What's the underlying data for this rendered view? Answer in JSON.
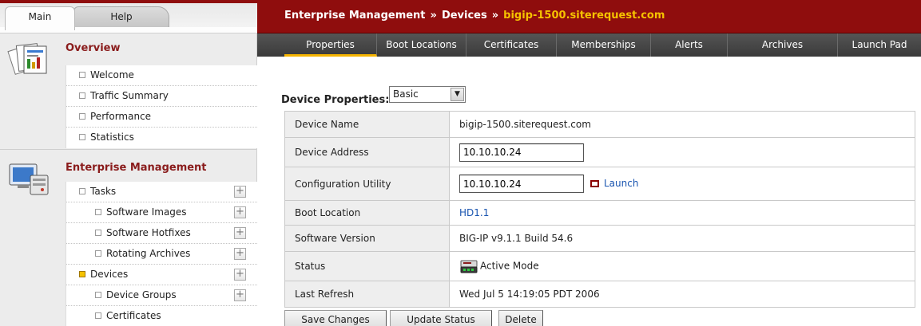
{
  "sidebar": {
    "tabs": {
      "main": "Main",
      "help": "Help"
    },
    "overview": {
      "title": "Overview",
      "items": [
        "Welcome",
        "Traffic Summary",
        "Performance",
        "Statistics"
      ]
    },
    "enterprise": {
      "title": "Enterprise Management",
      "items": {
        "tasks": "Tasks",
        "software_images": "Software Images",
        "software_hotfixes": "Software Hotfixes",
        "rotating_archives": "Rotating Archives",
        "devices": "Devices",
        "device_groups": "Device Groups",
        "certificates": "Certificates"
      }
    }
  },
  "breadcrumb": {
    "part1": "Enterprise Management",
    "part2": "Devices",
    "current": "bigip-1500.siterequest.com",
    "separator": "»"
  },
  "tabs": [
    "Properties",
    "Boot Locations",
    "Certificates",
    "Memberships",
    "Alerts",
    "Archives",
    "Launch Pad"
  ],
  "properties": {
    "label": "Device Properties:",
    "view": "Basic",
    "rows": {
      "device_name": {
        "label": "Device Name",
        "value": "bigip-1500.siterequest.com"
      },
      "device_address": {
        "label": "Device Address",
        "value": "10.10.10.24"
      },
      "config_utility": {
        "label": "Configuration Utility",
        "value": "10.10.10.24",
        "link": "Launch"
      },
      "boot_location": {
        "label": "Boot Location",
        "value": "HD1.1"
      },
      "software_version": {
        "label": "Software Version",
        "value": "BIG-IP v9.1.1 Build 54.6"
      },
      "status": {
        "label": "Status",
        "value": "Active Mode",
        "icon": "active-mode-icon"
      },
      "last_refresh": {
        "label": "Last Refresh",
        "value": "Wed Jul 5 14:19:05 PDT 2006"
      }
    }
  },
  "buttons": {
    "save": "Save Changes",
    "update": "Update Status",
    "delete": "Delete"
  },
  "colors": {
    "brand_red": "#8f0d0d",
    "highlight": "#f5c200",
    "link": "#1a55b0"
  }
}
